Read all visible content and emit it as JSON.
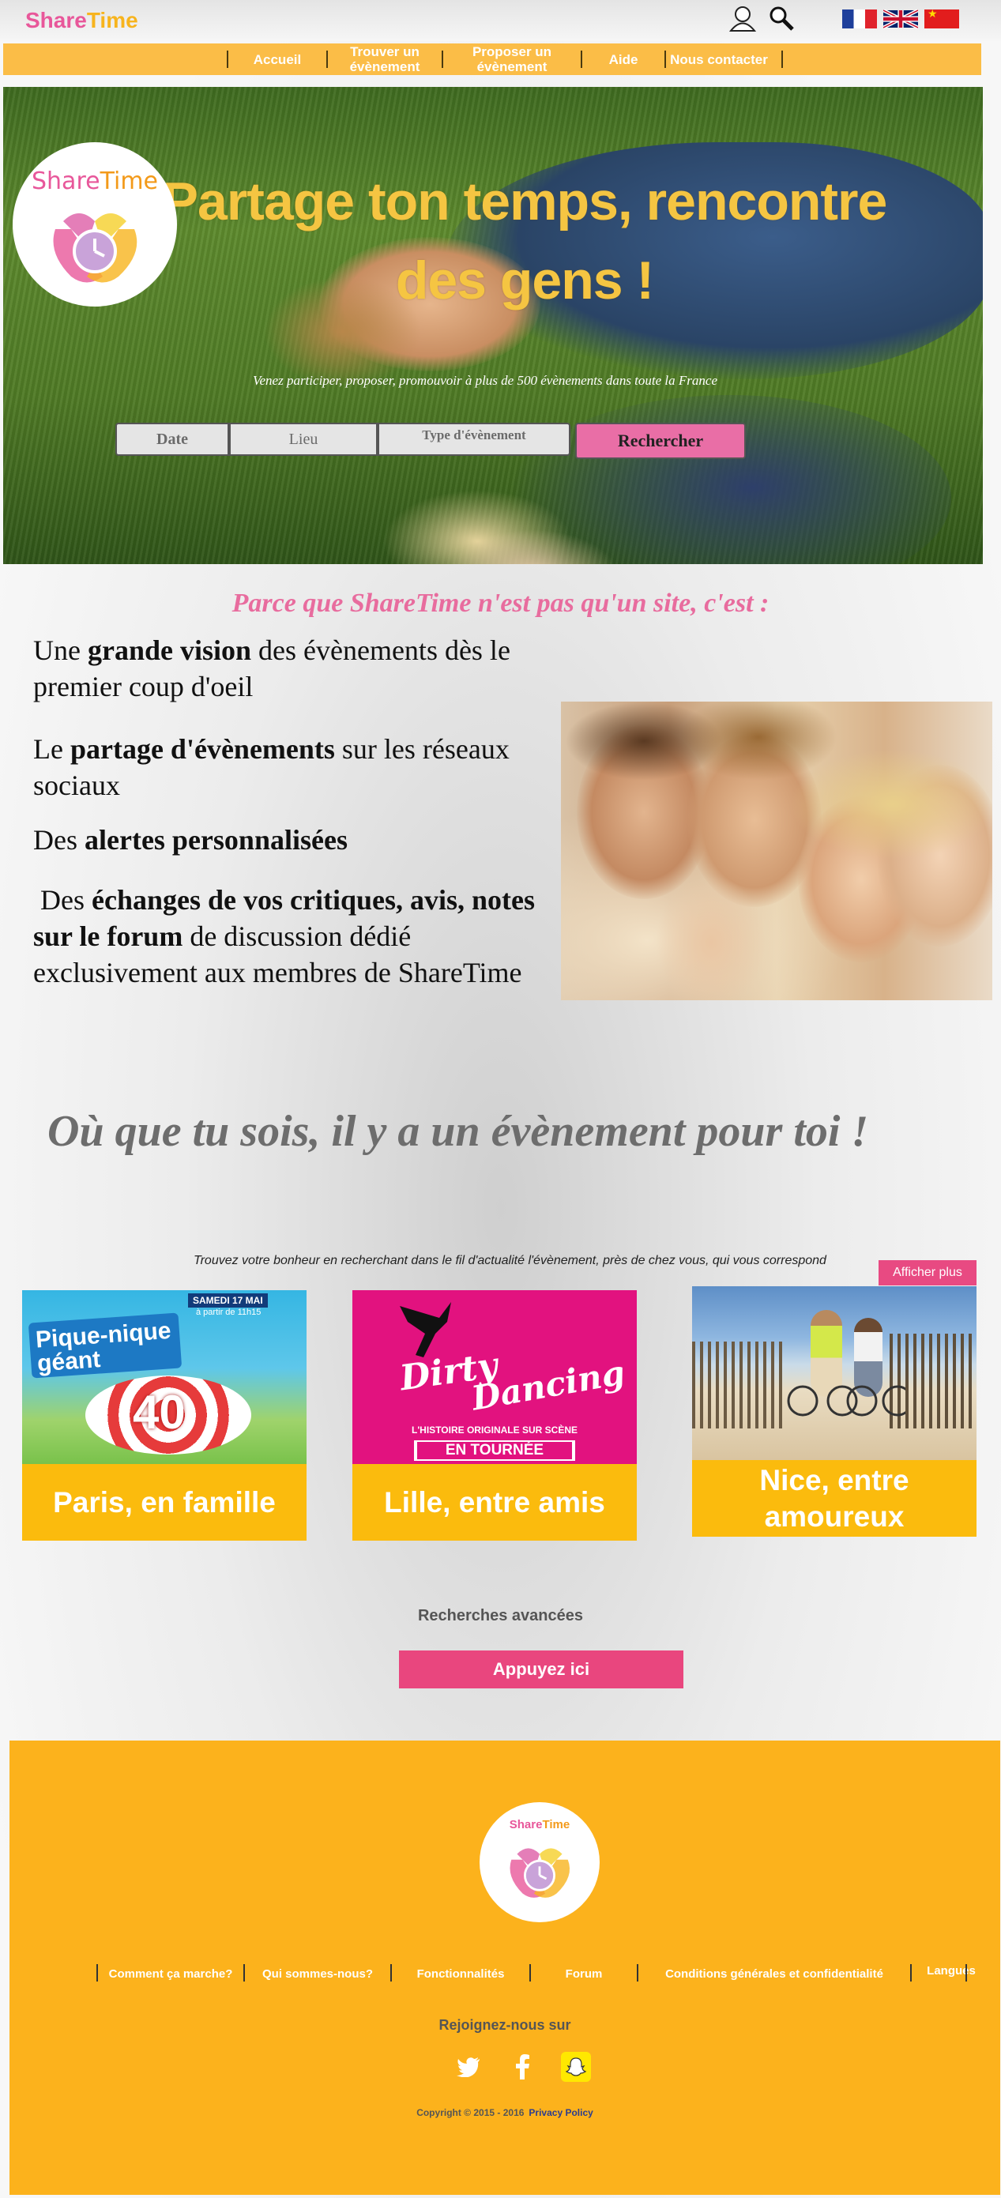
{
  "header": {
    "logo_share": "Share",
    "logo_time": "Time",
    "icons": [
      "user-icon",
      "search-icon"
    ],
    "languages": [
      "fr-flag-icon",
      "uk-flag-icon",
      "cn-flag-icon"
    ]
  },
  "nav": {
    "items": [
      {
        "label": "Accueil"
      },
      {
        "label": "Trouver un évènement"
      },
      {
        "label": "Proposer un évènement"
      },
      {
        "label": "Aide"
      },
      {
        "label": "Nous contacter"
      }
    ]
  },
  "hero": {
    "logo_share": "Share",
    "logo_time": "Time",
    "title": "Partage ton temps, rencontre des gens !",
    "subtitle": "Venez participer, proposer, promouvoir à plus de 500 évènements dans toute la France",
    "search": {
      "date_label": "Date",
      "place_label": "Lieu",
      "type_label": "Type d'évènement",
      "button_label": "Rechercher"
    }
  },
  "features": {
    "title": "Parce que ShareTime n'est pas qu'un site, c'est :",
    "items": [
      {
        "before": "Une ",
        "bold": "grande vision",
        "after": " des évènements dès le premier coup d'oeil"
      },
      {
        "before": "Le ",
        "bold": "partage d'évènements",
        "after": " sur les réseaux sociaux"
      },
      {
        "before": "Des ",
        "bold": "alertes personnalisées",
        "after": ""
      },
      {
        "before": " Des ",
        "bold": "échanges de vos critiques, avis, notes sur le forum",
        "after": " de discussion dédié exclusivement aux membres de ShareTime"
      }
    ]
  },
  "slogan": "Où que tu sois, il y a un évènement pour toi !",
  "events": {
    "intro": "Trouvez votre bonheur en recherchant dans le fil d'actualité l'évènement, près de chez vous, qui vous correspond",
    "more_label": "Afficher plus",
    "cards": [
      {
        "caption": "Paris, en famille",
        "poster_title": "Pique-nique géant",
        "poster_date": "SAMEDI 17 MAI",
        "poster_time": "à partir de 11h15",
        "poster_number": "40"
      },
      {
        "caption": "Lille, entre amis",
        "poster_title_1": "Dirty",
        "poster_title_2": "Dancing",
        "poster_subtitle": "L'HISTOIRE ORIGINALE SUR SCÈNE",
        "poster_banner": "EN TOURNÉE"
      },
      {
        "caption": "Nice, entre amoureux"
      }
    ]
  },
  "advanced": {
    "title": "Recherches avancées",
    "button_label": "Appuyez ici"
  },
  "footer": {
    "logo_share": "Share",
    "logo_time": "Time",
    "links": [
      {
        "label": "Comment ça marche?"
      },
      {
        "label": "Qui sommes-nous?"
      },
      {
        "label": "Fonctionnalités"
      },
      {
        "label": "Forum"
      },
      {
        "label": "Conditions générales et confidentialité"
      },
      {
        "label": "Langues"
      }
    ],
    "join": "Rejoignez-nous sur",
    "socials": [
      "twitter-icon",
      "facebook-icon",
      "snapchat-icon"
    ],
    "copyright": "Copyright © 2015 - 2016",
    "privacy": "Privacy Policy"
  },
  "colors": {
    "brand_pink": "#e8579a",
    "brand_yellow": "#f7b41e",
    "nav_yellow": "#fbbd47",
    "footer_yellow": "#fcb21c",
    "caption_yellow": "#fbbb0d",
    "button_pink": "#e9467e"
  }
}
